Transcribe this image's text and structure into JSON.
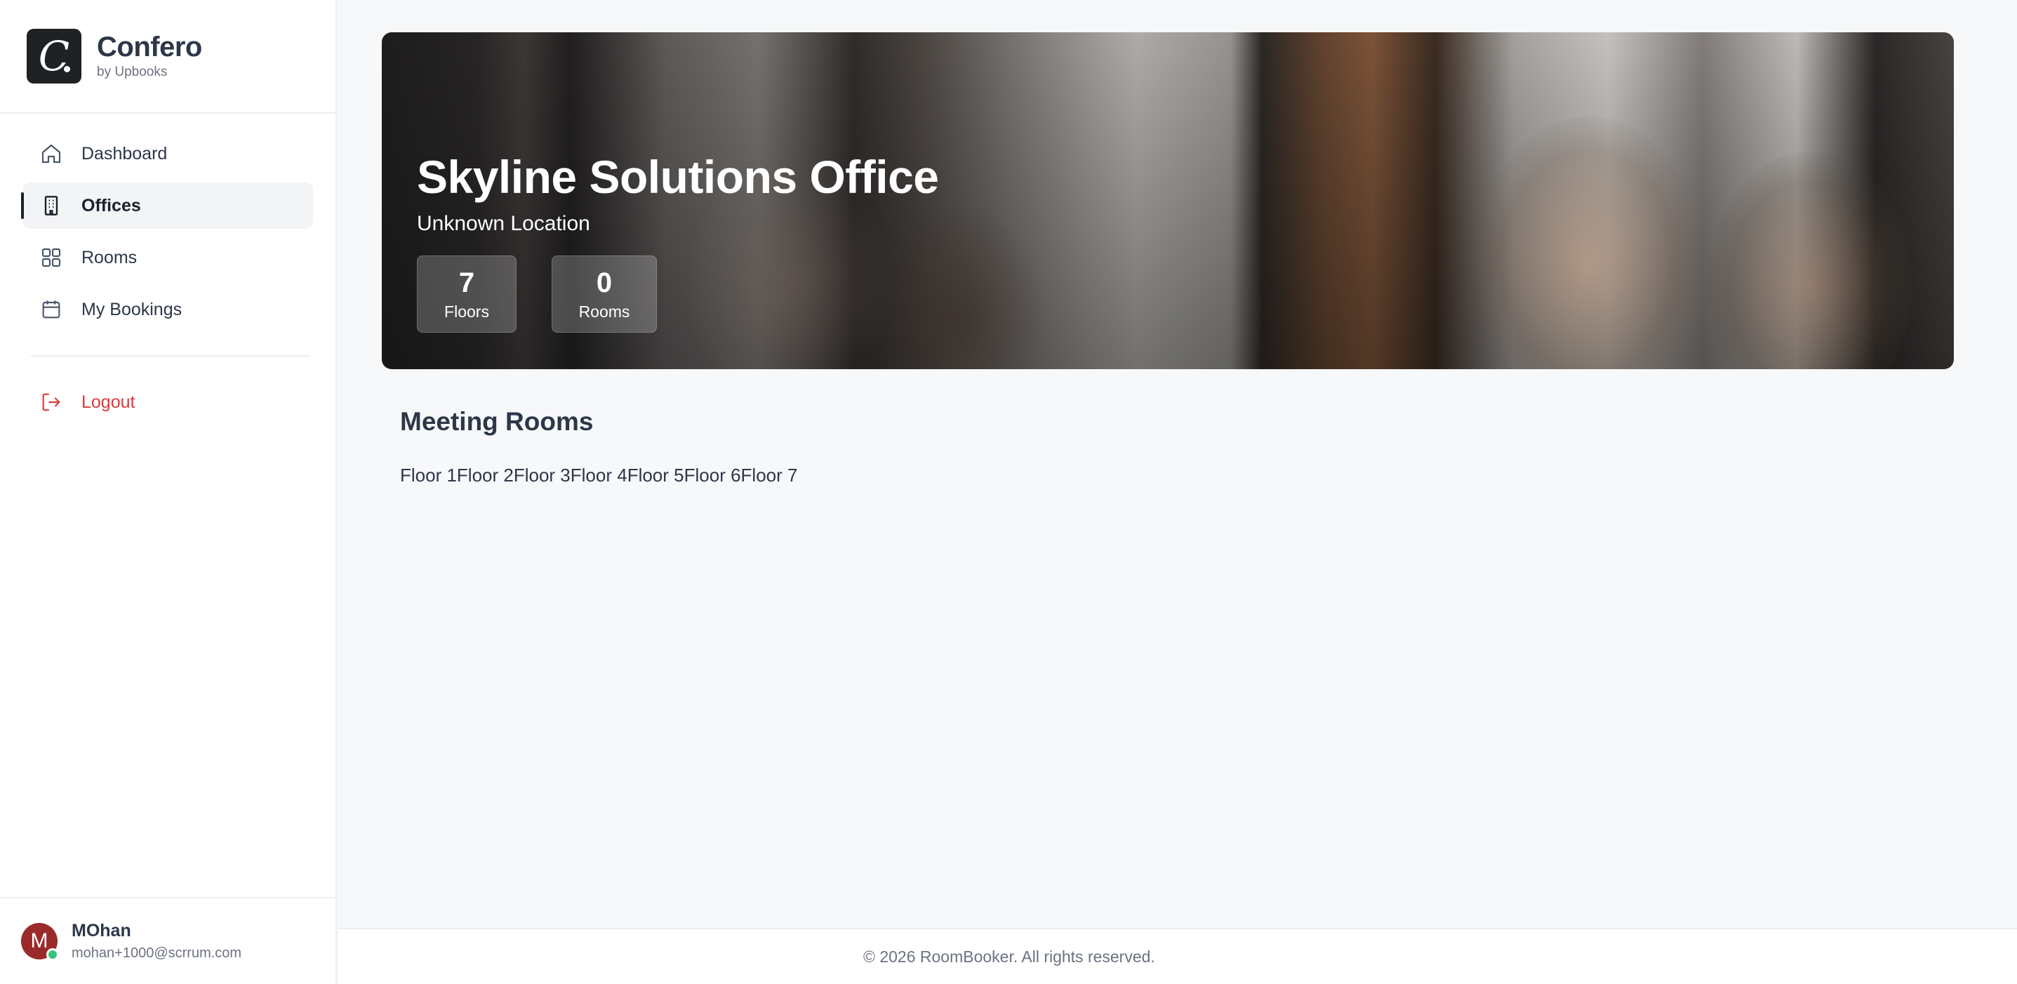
{
  "brand": {
    "logo_letter": "C",
    "name": "Confero",
    "subtitle": "by Upbooks"
  },
  "sidebar": {
    "items": [
      {
        "label": "Dashboard",
        "icon": "home-icon",
        "active": false
      },
      {
        "label": "Offices",
        "icon": "building-icon",
        "active": true
      },
      {
        "label": "Rooms",
        "icon": "grid-icon",
        "active": false
      },
      {
        "label": "My Bookings",
        "icon": "calendar-icon",
        "active": false
      }
    ],
    "logout": {
      "label": "Logout",
      "icon": "logout-icon"
    }
  },
  "user": {
    "initial": "M",
    "name": "MOhan",
    "email": "mohan+1000@scrrum.com",
    "status": "online"
  },
  "hero": {
    "title": "Skyline Solutions Office",
    "location": "Unknown Location",
    "stats": [
      {
        "value": "7",
        "label": "Floors"
      },
      {
        "value": "0",
        "label": "Rooms"
      }
    ]
  },
  "meeting_rooms": {
    "title": "Meeting Rooms",
    "floors": [
      "Floor 1",
      "Floor 2",
      "Floor 3",
      "Floor 4",
      "Floor 5",
      "Floor 6",
      "Floor 7"
    ]
  },
  "footer": {
    "text": "© 2026 RoomBooker. All rights reserved."
  },
  "colors": {
    "accent_dark": "#1f2225",
    "logout_red": "#dc3b3b",
    "status_green": "#34c47c",
    "avatar_red": "#9b2a2a"
  }
}
